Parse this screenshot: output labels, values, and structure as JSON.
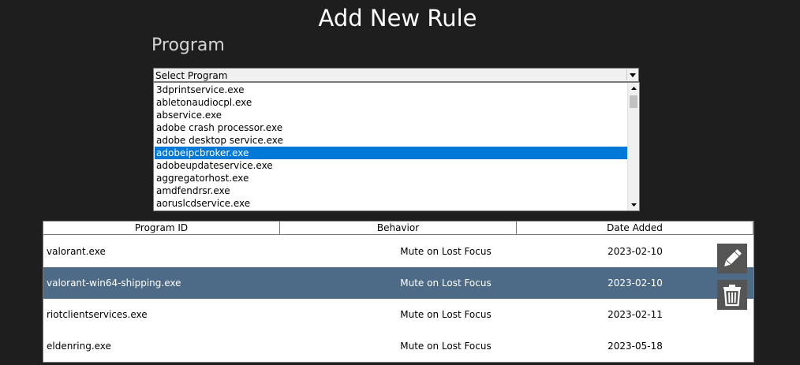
{
  "title": "Add New Rule",
  "program_section": {
    "label": "Program",
    "select": {
      "value": "Select Program",
      "options": [
        "3dprintservice.exe",
        "abletonaudiocpl.exe",
        "abservice.exe",
        "adobe crash processor.exe",
        "adobe desktop service.exe",
        "adobeipcbroker.exe",
        "adobeupdateservice.exe",
        "aggregatorhost.exe",
        "amdfendrsr.exe",
        "aoruslcdservice.exe"
      ],
      "highlighted_option": "adobeipcbroker.exe"
    }
  },
  "table": {
    "columns": [
      "Program ID",
      "Behavior",
      "Date Added"
    ],
    "rows": [
      {
        "program": "valorant.exe",
        "behavior": "Mute on Lost Focus",
        "date": "2023-02-10"
      },
      {
        "program": "valorant-win64-shipping.exe",
        "behavior": "Mute on Lost Focus",
        "date": "2023-02-10",
        "selected": true
      },
      {
        "program": "riotclientservices.exe",
        "behavior": "Mute on Lost Focus",
        "date": "2023-02-11"
      },
      {
        "program": "eldenring.exe",
        "behavior": "Mute on Lost Focus",
        "date": "2023-05-18"
      }
    ]
  },
  "actions": {
    "edit_icon": "pencil-icon",
    "delete_icon": "trash-icon"
  },
  "colors": {
    "background": "#1e1e1e",
    "selection_list": "#0078d7",
    "selection_table": "#4d6b86",
    "action_button": "#555555"
  }
}
